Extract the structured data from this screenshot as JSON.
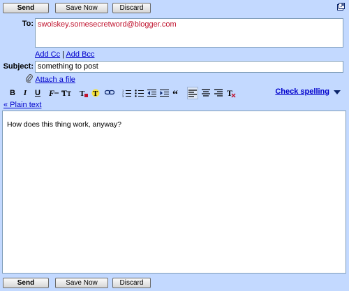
{
  "top_buttons": {
    "send": "Send",
    "save_now": "Save Now",
    "discard": "Discard"
  },
  "bottom_buttons": {
    "send": "Send",
    "save_now": "Save Now",
    "discard": "Discard"
  },
  "to": {
    "label": "To:",
    "value": "swolskey.somesecretword@blogger.com"
  },
  "add_cc": "Add Cc",
  "separator": "|",
  "add_bcc": "Add Bcc",
  "subject": {
    "label": "Subject:",
    "value": "something to post"
  },
  "attach_file": "Attach a file",
  "toolbar": {
    "bold": "B",
    "italic": "I",
    "underline": "U",
    "check_spelling": "Check spelling"
  },
  "plain_text": "« Plain text",
  "body_text": "How does this thing work, anyway?",
  "colors": {
    "panel": "#c3d9ff",
    "link": "#0000cc",
    "recipient": "#c0132e"
  }
}
